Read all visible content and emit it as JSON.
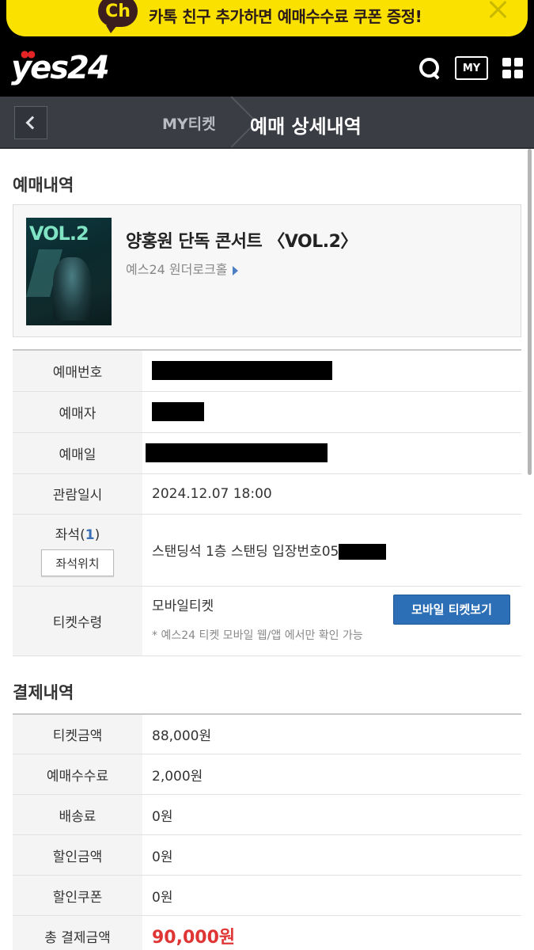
{
  "banner": {
    "icon_text": "Ch",
    "text": "카톡 친구 추가하면 예매수수료 쿠폰 증정!"
  },
  "header": {
    "logo": "yes24",
    "my_label": "MY"
  },
  "subnav": {
    "parent": "MY티켓",
    "current": "예매 상세내역"
  },
  "booking": {
    "section_title": "예매내역",
    "event": {
      "poster_text": "VOL.2",
      "title": "양홍원 단독 콘서트 〈VOL.2〉",
      "venue": "예스24 원더로크홀"
    },
    "rows": {
      "number_label": "예매번호",
      "booker_label": "예매자",
      "date_label": "예매일",
      "showtime_label": "관람일시",
      "showtime_value": "2024.12.07 18:00",
      "seat_label": "좌석(",
      "seat_count": "1",
      "seat_label_end": ")",
      "seat_button": "좌석위치",
      "seat_value": "스탠딩석 1층 스탠딩 입장번호05",
      "ticket_label": "티켓수령",
      "ticket_value": "모바일티켓",
      "mobile_button": "모바일 티켓보기",
      "ticket_note": "* 예스24 티켓 모바일 웹/앱 에서만 확인 가능"
    }
  },
  "payment": {
    "section_title": "결제내역",
    "rows": [
      {
        "label": "티켓금액",
        "value": "88,000원"
      },
      {
        "label": "예매수수료",
        "value": "2,000원"
      },
      {
        "label": "배송료",
        "value": "0원"
      },
      {
        "label": "할인금액",
        "value": "0원"
      },
      {
        "label": "할인쿠폰",
        "value": "0원"
      }
    ],
    "total_label": "총 결제금액",
    "total_value": "90,000원"
  }
}
